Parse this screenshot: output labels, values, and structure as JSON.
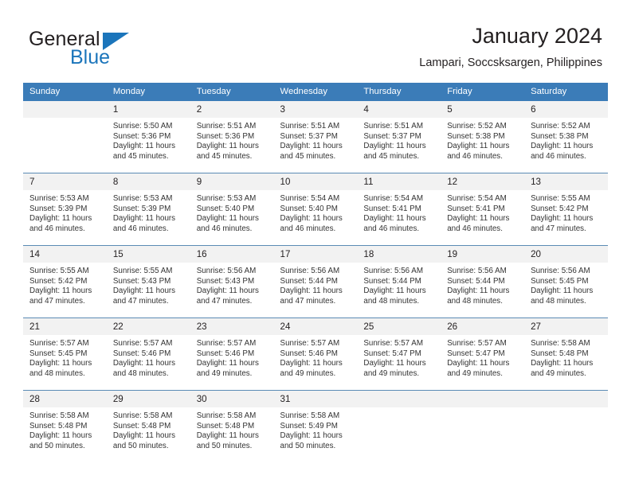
{
  "brand": {
    "name_part1": "General",
    "name_part2": "Blue",
    "triangle_color": "#1b75bb",
    "text_color": "#231f20"
  },
  "header": {
    "title": "January 2024",
    "subtitle": "Lampari, Soccsksargen, Philippines"
  },
  "theme": {
    "header_bg": "#3b7cb8",
    "header_text": "#ffffff",
    "daynum_bg": "#f2f2f2",
    "row_separator": "#5b8bb5",
    "body_text": "#333333"
  },
  "calendar": {
    "weekday_headers": [
      "Sunday",
      "Monday",
      "Tuesday",
      "Wednesday",
      "Thursday",
      "Friday",
      "Saturday"
    ],
    "weeks": [
      [
        {
          "day": "",
          "lines": []
        },
        {
          "day": "1",
          "lines": [
            "Sunrise: 5:50 AM",
            "Sunset: 5:36 PM",
            "Daylight: 11 hours",
            "and 45 minutes."
          ]
        },
        {
          "day": "2",
          "lines": [
            "Sunrise: 5:51 AM",
            "Sunset: 5:36 PM",
            "Daylight: 11 hours",
            "and 45 minutes."
          ]
        },
        {
          "day": "3",
          "lines": [
            "Sunrise: 5:51 AM",
            "Sunset: 5:37 PM",
            "Daylight: 11 hours",
            "and 45 minutes."
          ]
        },
        {
          "day": "4",
          "lines": [
            "Sunrise: 5:51 AM",
            "Sunset: 5:37 PM",
            "Daylight: 11 hours",
            "and 45 minutes."
          ]
        },
        {
          "day": "5",
          "lines": [
            "Sunrise: 5:52 AM",
            "Sunset: 5:38 PM",
            "Daylight: 11 hours",
            "and 46 minutes."
          ]
        },
        {
          "day": "6",
          "lines": [
            "Sunrise: 5:52 AM",
            "Sunset: 5:38 PM",
            "Daylight: 11 hours",
            "and 46 minutes."
          ]
        }
      ],
      [
        {
          "day": "7",
          "lines": [
            "Sunrise: 5:53 AM",
            "Sunset: 5:39 PM",
            "Daylight: 11 hours",
            "and 46 minutes."
          ]
        },
        {
          "day": "8",
          "lines": [
            "Sunrise: 5:53 AM",
            "Sunset: 5:39 PM",
            "Daylight: 11 hours",
            "and 46 minutes."
          ]
        },
        {
          "day": "9",
          "lines": [
            "Sunrise: 5:53 AM",
            "Sunset: 5:40 PM",
            "Daylight: 11 hours",
            "and 46 minutes."
          ]
        },
        {
          "day": "10",
          "lines": [
            "Sunrise: 5:54 AM",
            "Sunset: 5:40 PM",
            "Daylight: 11 hours",
            "and 46 minutes."
          ]
        },
        {
          "day": "11",
          "lines": [
            "Sunrise: 5:54 AM",
            "Sunset: 5:41 PM",
            "Daylight: 11 hours",
            "and 46 minutes."
          ]
        },
        {
          "day": "12",
          "lines": [
            "Sunrise: 5:54 AM",
            "Sunset: 5:41 PM",
            "Daylight: 11 hours",
            "and 46 minutes."
          ]
        },
        {
          "day": "13",
          "lines": [
            "Sunrise: 5:55 AM",
            "Sunset: 5:42 PM",
            "Daylight: 11 hours",
            "and 47 minutes."
          ]
        }
      ],
      [
        {
          "day": "14",
          "lines": [
            "Sunrise: 5:55 AM",
            "Sunset: 5:42 PM",
            "Daylight: 11 hours",
            "and 47 minutes."
          ]
        },
        {
          "day": "15",
          "lines": [
            "Sunrise: 5:55 AM",
            "Sunset: 5:43 PM",
            "Daylight: 11 hours",
            "and 47 minutes."
          ]
        },
        {
          "day": "16",
          "lines": [
            "Sunrise: 5:56 AM",
            "Sunset: 5:43 PM",
            "Daylight: 11 hours",
            "and 47 minutes."
          ]
        },
        {
          "day": "17",
          "lines": [
            "Sunrise: 5:56 AM",
            "Sunset: 5:44 PM",
            "Daylight: 11 hours",
            "and 47 minutes."
          ]
        },
        {
          "day": "18",
          "lines": [
            "Sunrise: 5:56 AM",
            "Sunset: 5:44 PM",
            "Daylight: 11 hours",
            "and 48 minutes."
          ]
        },
        {
          "day": "19",
          "lines": [
            "Sunrise: 5:56 AM",
            "Sunset: 5:44 PM",
            "Daylight: 11 hours",
            "and 48 minutes."
          ]
        },
        {
          "day": "20",
          "lines": [
            "Sunrise: 5:56 AM",
            "Sunset: 5:45 PM",
            "Daylight: 11 hours",
            "and 48 minutes."
          ]
        }
      ],
      [
        {
          "day": "21",
          "lines": [
            "Sunrise: 5:57 AM",
            "Sunset: 5:45 PM",
            "Daylight: 11 hours",
            "and 48 minutes."
          ]
        },
        {
          "day": "22",
          "lines": [
            "Sunrise: 5:57 AM",
            "Sunset: 5:46 PM",
            "Daylight: 11 hours",
            "and 48 minutes."
          ]
        },
        {
          "day": "23",
          "lines": [
            "Sunrise: 5:57 AM",
            "Sunset: 5:46 PM",
            "Daylight: 11 hours",
            "and 49 minutes."
          ]
        },
        {
          "day": "24",
          "lines": [
            "Sunrise: 5:57 AM",
            "Sunset: 5:46 PM",
            "Daylight: 11 hours",
            "and 49 minutes."
          ]
        },
        {
          "day": "25",
          "lines": [
            "Sunrise: 5:57 AM",
            "Sunset: 5:47 PM",
            "Daylight: 11 hours",
            "and 49 minutes."
          ]
        },
        {
          "day": "26",
          "lines": [
            "Sunrise: 5:57 AM",
            "Sunset: 5:47 PM",
            "Daylight: 11 hours",
            "and 49 minutes."
          ]
        },
        {
          "day": "27",
          "lines": [
            "Sunrise: 5:58 AM",
            "Sunset: 5:48 PM",
            "Daylight: 11 hours",
            "and 49 minutes."
          ]
        }
      ],
      [
        {
          "day": "28",
          "lines": [
            "Sunrise: 5:58 AM",
            "Sunset: 5:48 PM",
            "Daylight: 11 hours",
            "and 50 minutes."
          ]
        },
        {
          "day": "29",
          "lines": [
            "Sunrise: 5:58 AM",
            "Sunset: 5:48 PM",
            "Daylight: 11 hours",
            "and 50 minutes."
          ]
        },
        {
          "day": "30",
          "lines": [
            "Sunrise: 5:58 AM",
            "Sunset: 5:48 PM",
            "Daylight: 11 hours",
            "and 50 minutes."
          ]
        },
        {
          "day": "31",
          "lines": [
            "Sunrise: 5:58 AM",
            "Sunset: 5:49 PM",
            "Daylight: 11 hours",
            "and 50 minutes."
          ]
        },
        {
          "day": "",
          "lines": []
        },
        {
          "day": "",
          "lines": []
        },
        {
          "day": "",
          "lines": []
        }
      ]
    ]
  }
}
